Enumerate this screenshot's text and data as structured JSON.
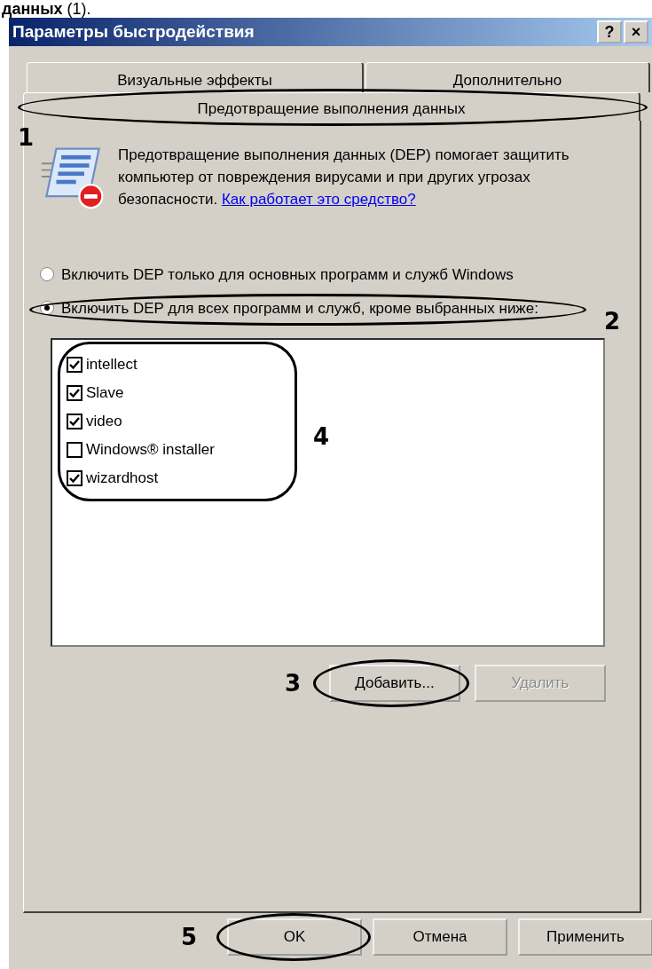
{
  "caption_fragment": "**данных** (1).",
  "window": {
    "title": "Параметры быстродействия",
    "help_button": "?",
    "close_button": "×"
  },
  "tabs": [
    {
      "label": "Визуальные эффекты",
      "selected": false
    },
    {
      "label": "Дополнительно",
      "selected": false
    },
    {
      "label": "Предотвращение выполнения данных",
      "selected": true,
      "callout": "1"
    }
  ],
  "description": {
    "text": "Предотвращение выполнения данных (DEP) помогает защитить компьютер от повреждения вирусами и при других угрозах безопасности.",
    "link": "Как работает это средство?"
  },
  "radios": [
    {
      "label": "Включить DEP только для основных программ и служб Windows",
      "selected": false
    },
    {
      "label": "Включить DEP для всех программ и служб, кроме выбранных ниже:",
      "selected": true,
      "callout": "2"
    }
  ],
  "programs": {
    "callout": "4",
    "items": [
      {
        "name": "intellect",
        "checked": true
      },
      {
        "name": "Slave",
        "checked": true
      },
      {
        "name": "video",
        "checked": true
      },
      {
        "name": "Windows® installer",
        "checked": false
      },
      {
        "name": "wizardhost",
        "checked": true
      }
    ]
  },
  "list_buttons": [
    {
      "label": "Добавить...",
      "disabled": false,
      "callout": "3"
    },
    {
      "label": "Удалить",
      "disabled": true
    }
  ],
  "dialog_buttons": [
    {
      "label": "OK",
      "callout": "5"
    },
    {
      "label": "Отмена"
    },
    {
      "label": "Применить"
    }
  ]
}
